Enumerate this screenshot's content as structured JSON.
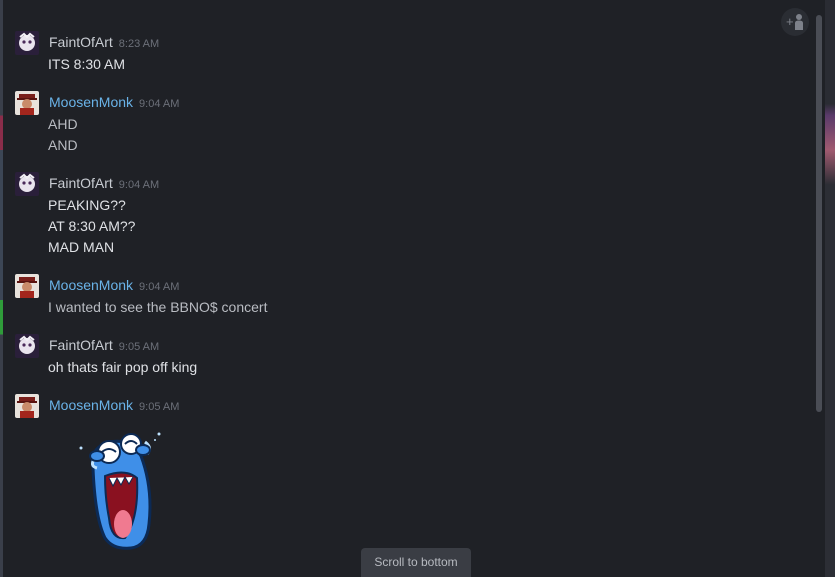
{
  "messages": [
    {
      "user": "FaintOfArt",
      "time": "8:23 AM",
      "lines": [
        "ITS 8:30 AM"
      ]
    },
    {
      "user": "MoosenMonk",
      "time": "9:04 AM",
      "lines": [
        "AHD",
        "AND"
      ]
    },
    {
      "user": "FaintOfArt",
      "time": "9:04 AM",
      "lines": [
        "PEAKING??",
        "AT 8:30 AM??",
        "MAD MAN"
      ]
    },
    {
      "user": "MoosenMonk",
      "time": "9:04 AM",
      "lines": [
        "I wanted to see the BBNO$ concert"
      ]
    },
    {
      "user": "FaintOfArt",
      "time": "9:05 AM",
      "lines": [
        "oh thats fair pop off king"
      ]
    },
    {
      "user": "MoosenMonk",
      "time": "9:05 AM",
      "lines": []
    }
  ],
  "scroll_to_bottom_label": "Scroll to bottom",
  "icons": {
    "invite": "add-person-icon",
    "sticker": "laughing-blob-sticker"
  },
  "colors": {
    "background": "#1f2126",
    "name_blue": "#6ab3e8",
    "name_white": "#c8ccd2",
    "timestamp": "#6c7079"
  }
}
